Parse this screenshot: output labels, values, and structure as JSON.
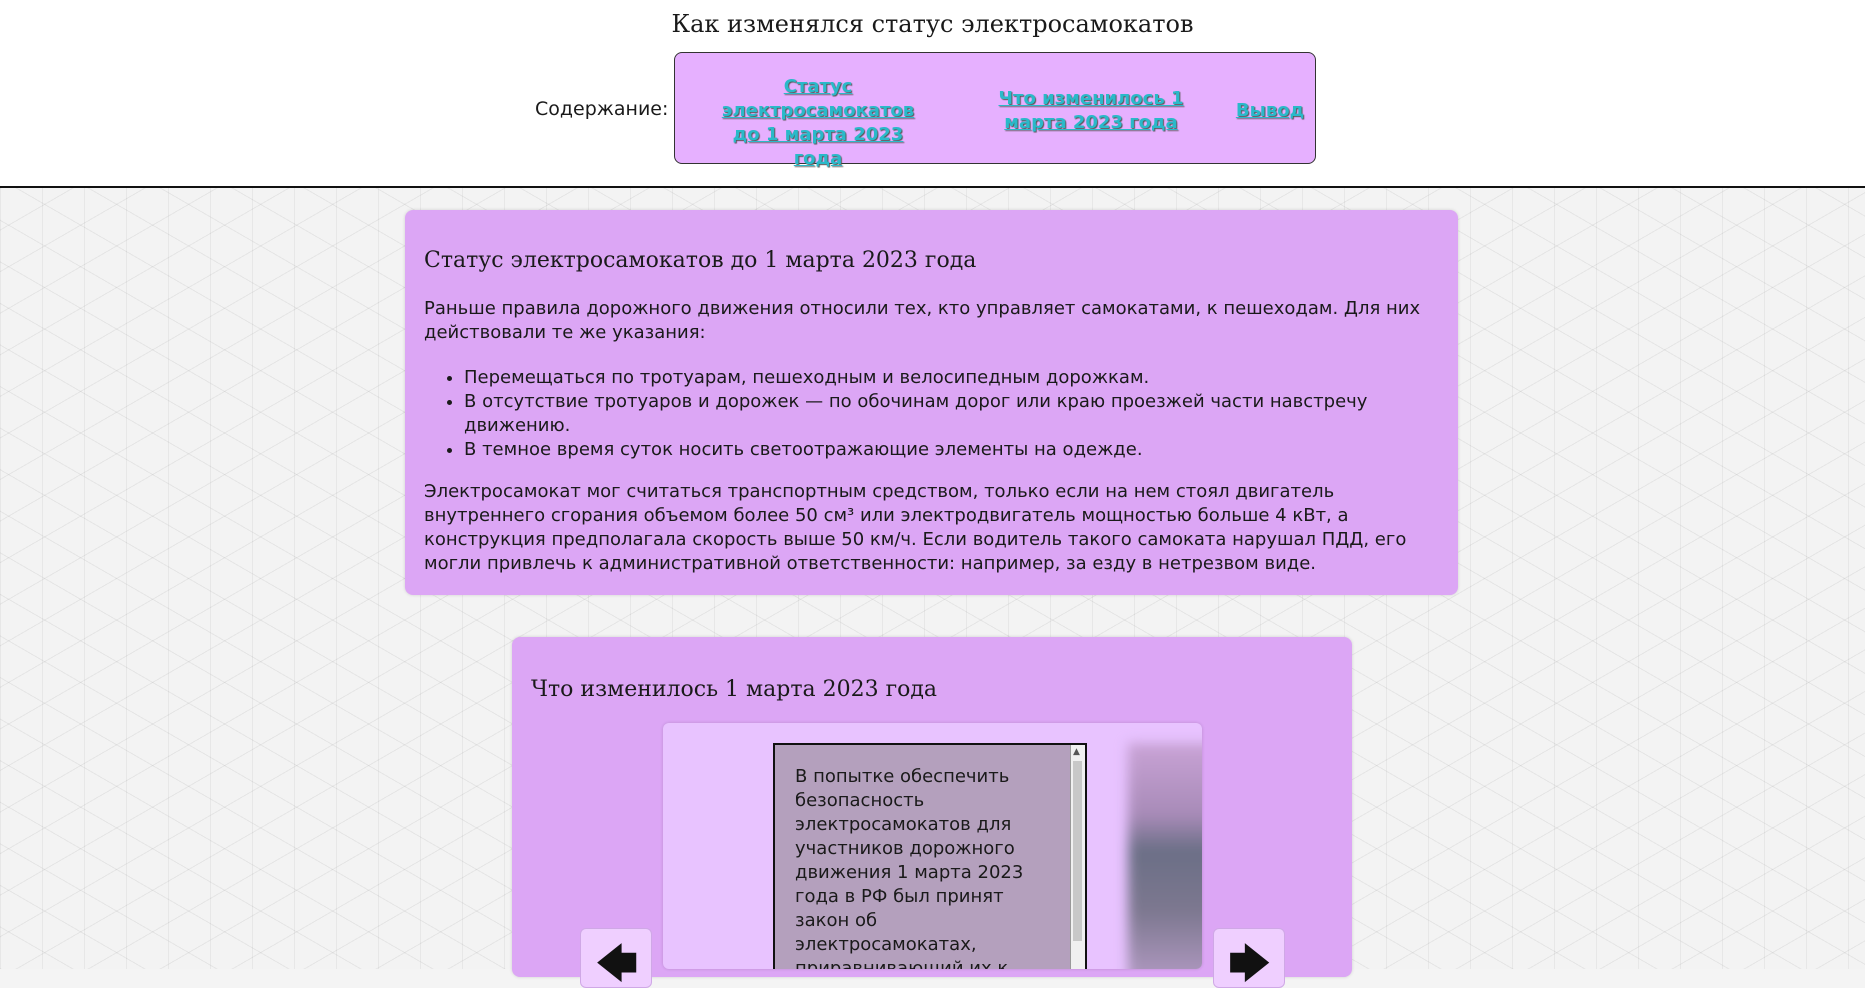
{
  "header": {
    "title": "Как изменялся статус электросамокатов",
    "toc_label": "Содержание:",
    "toc_links": [
      "Статус электросамокатов до 1 марта 2023 года",
      "Что изменилось 1 марта 2023 года",
      "Вывод"
    ]
  },
  "section1": {
    "heading": "Статус электросамокатов до 1 марта 2023 года",
    "intro": "Раньше правила дорожного движения относили тех, кто управляет самокатами, к пешеходам. Для них действовали те же указания:",
    "rules": [
      "Перемещаться по тротуарам, пешеходным и велосипедным дорожкам.",
      "В отсутствие тротуаров и дорожек — по обочинам дорог или краю проезжей части навстречу движению.",
      "В темное время суток носить светоотражающие элементы на одежде."
    ],
    "outro": "Электросамокат мог считаться транспортным средством, только если на нем стоял двигатель внутреннего сгорания объемом более 50 см³ или электродвигатель мощностью больше 4 кВт, а конструкция предполагала скорость выше 50 км/ч. Если водитель такого самоката нарушал ПДД, его могли привлечь к административной ответственности: например, за езду в нетрезвом виде."
  },
  "section2": {
    "heading": "Что изменилось 1 марта 2023 года",
    "slide_text": "В попытке обеспечить безопасность электросамокатов для участников дорожного движения 1 марта 2023 года в РФ был принят закон об электросамокатах, приравнивающий их к"
  },
  "icons": {
    "prev": "arrow-left-icon",
    "next": "arrow-right-icon"
  },
  "colors": {
    "card_bg": "#dca6f5",
    "toc_bg": "#e6b0ff",
    "link": "#2ab9c9"
  }
}
